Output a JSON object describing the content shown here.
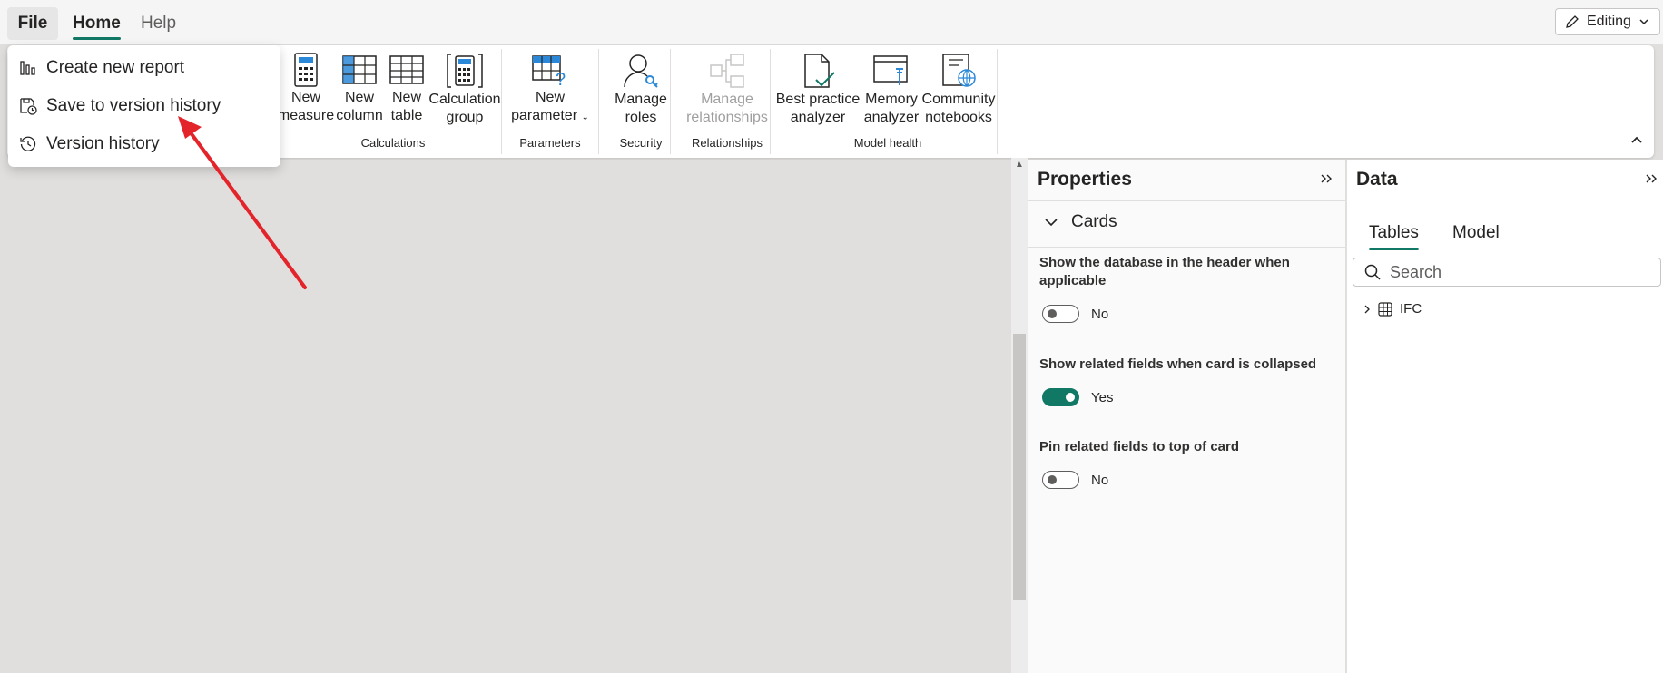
{
  "menu": {
    "file": "File",
    "home": "Home",
    "help": "Help"
  },
  "mode": {
    "label": "Editing"
  },
  "file_menu": {
    "items": [
      {
        "label": "Create new report",
        "icon": "bar-chart-icon"
      },
      {
        "label": "Save to version history",
        "icon": "save-history-icon"
      },
      {
        "label": "Version history",
        "icon": "history-icon"
      }
    ]
  },
  "ribbon": {
    "buttons": {
      "new_measure": [
        "New",
        "measure"
      ],
      "new_column": [
        "New",
        "column"
      ],
      "new_table": [
        "New",
        "table"
      ],
      "calc_group": [
        "Calculation",
        "group"
      ],
      "new_parameter": [
        "New",
        "parameter"
      ],
      "manage_roles": [
        "Manage",
        "roles"
      ],
      "manage_relationships": [
        "Manage",
        "relationships"
      ],
      "best_practice": [
        "Best practice",
        "analyzer"
      ],
      "memory_analyzer": [
        "Memory",
        "analyzer"
      ],
      "community_notebooks": [
        "Community",
        "notebooks"
      ]
    },
    "groups": {
      "calculations": "Calculations",
      "parameters": "Parameters",
      "security": "Security",
      "relationships": "Relationships",
      "model_health": "Model health"
    }
  },
  "properties": {
    "title": "Properties",
    "section": "Cards",
    "settings": [
      {
        "label": "Show the database in the header when applicable",
        "state": "No",
        "on": false
      },
      {
        "label": "Show related fields when card is collapsed",
        "state": "Yes",
        "on": true
      },
      {
        "label": "Pin related fields to top of card",
        "state": "No",
        "on": false
      }
    ]
  },
  "data_pane": {
    "title": "Data",
    "tabs": [
      "Tables",
      "Model"
    ],
    "search_placeholder": "Search",
    "tables": [
      "IFC"
    ]
  },
  "colors": {
    "accent": "#117865",
    "canvas": "#e1dfdd",
    "annotation_arrow": "#e3242b"
  }
}
